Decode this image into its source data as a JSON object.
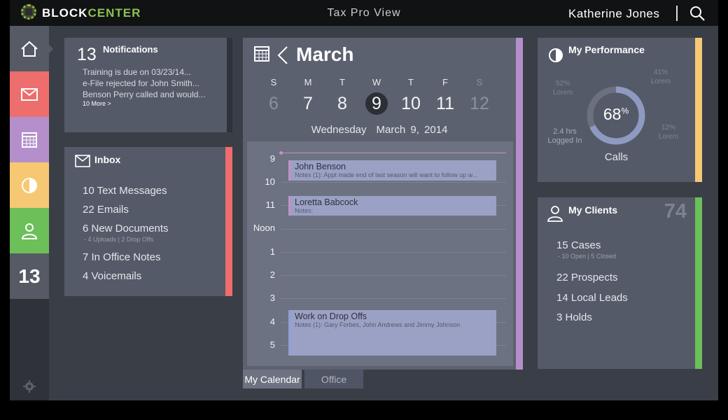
{
  "header": {
    "brand_part1": "BLOCK",
    "brand_part2": "CENTER",
    "view_title": "Tax Pro View",
    "user_name": "Katherine Jones"
  },
  "nav": {
    "count_badge": "13",
    "colors": {
      "mail": "#ee6d6d",
      "calendar": "#b48fcb",
      "performance": "#f7c873",
      "clients": "#6cbf59"
    }
  },
  "notifications": {
    "count": "13",
    "title": "Notifications",
    "items": [
      "Training is due on 03/23/14...",
      "e-File rejected for John Smith...",
      "Benson Perry called and would..."
    ],
    "more": "10 More >"
  },
  "inbox": {
    "title": "Inbox",
    "items": [
      "10 Text Messages",
      "22 Emails",
      "6 New Documents",
      "7 In Office Notes",
      "4 Voicemails"
    ],
    "documents_sub": "- 4 Uploads | 2 Drop Offs"
  },
  "calendar": {
    "month": "March",
    "weekdays": [
      "S",
      "M",
      "T",
      "W",
      "T",
      "F",
      "S"
    ],
    "days": [
      "6",
      "7",
      "8",
      "9",
      "10",
      "11",
      "12"
    ],
    "selected_day": "9",
    "selected_weekday": "Wednesday",
    "selected_date": "March 9, 2014",
    "hours": [
      "9",
      "10",
      "11",
      "Noon",
      "1",
      "2",
      "3",
      "4",
      "5"
    ],
    "events": [
      {
        "title": "John Benson",
        "notes": "Notes (1): Appt made end of last season will want to follow up w..."
      },
      {
        "title": "Loretta Babcock",
        "notes": "Notes:"
      },
      {
        "title": "Work on Drop Offs",
        "notes": "Notes (1): Gary Forbes, John Andrews and Jimmy Johnson"
      }
    ],
    "tabs": [
      "My Calendar",
      "Office"
    ]
  },
  "performance": {
    "title": "My Performance",
    "stat_tl_value": "52%",
    "stat_tl_label": "Lorem",
    "stat_tr_value": "41%",
    "stat_tr_label": "Lorem",
    "stat_bl_value": "2.4 hrs",
    "stat_bl_label": "Logged In",
    "stat_br_value": "12%",
    "stat_br_label": "Lorem",
    "calls_value": "68",
    "calls_unit": "%",
    "calls_fraction": 0.68,
    "calls_label": "Calls"
  },
  "clients": {
    "title": "My Clients",
    "count": "74",
    "cases": "15 Cases",
    "cases_sub": "- 10 Open | 5 Closed",
    "prospects": "22 Prospects",
    "leads": "14 Local Leads",
    "holds": "3 Holds"
  }
}
